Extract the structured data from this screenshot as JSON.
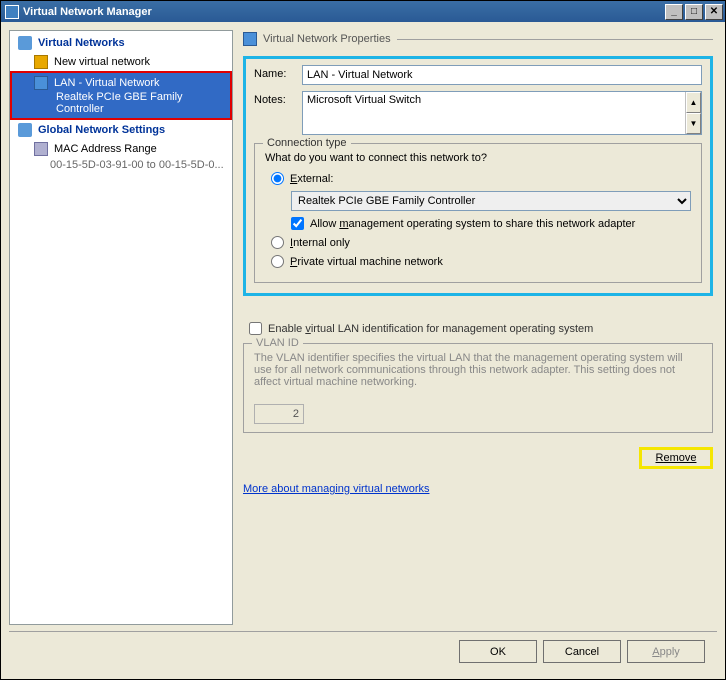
{
  "window": {
    "title": "Virtual Network Manager"
  },
  "sidebar": {
    "section1": "Virtual Networks",
    "new_item": "New virtual network",
    "selected": {
      "name": "LAN - Virtual Network",
      "adapter": "Realtek PCIe GBE Family Controller"
    },
    "section2": "Global Network Settings",
    "mac_label": "MAC Address Range",
    "mac_range": "00-15-5D-03-91-00 to 00-15-5D-0..."
  },
  "props": {
    "section_title": "Virtual Network Properties",
    "name_label": "Name:",
    "name_value": "LAN - Virtual Network",
    "notes_label": "Notes:",
    "notes_value": "Microsoft Virtual Switch",
    "conn": {
      "legend": "Connection type",
      "question": "What do you want to connect this network to?",
      "external_label": "External:",
      "external_u": "E",
      "adapter": "Realtek PCIe GBE Family Controller",
      "allow_label_pre": "Allow ",
      "allow_u": "m",
      "allow_label_post": "anagement operating system to share this network adapter",
      "internal_label": "nternal only",
      "internal_u": "I",
      "private_label": "rivate virtual machine network",
      "private_u": "P"
    },
    "vlan_check_pre": "Enable ",
    "vlan_check_u": "v",
    "vlan_check_post": "irtual LAN identification for management operating system",
    "vlan": {
      "legend": "VLAN ID",
      "desc": "The VLAN identifier specifies the virtual LAN that the management operating system will use for all network communications through this network adapter. This setting does not affect virtual machine networking.",
      "value": "2"
    },
    "remove_u": "R",
    "remove_post": "emove",
    "link": "More about managing virtual networks"
  },
  "footer": {
    "ok": "OK",
    "cancel": "Cancel",
    "apply_u": "A",
    "apply_post": "pply"
  }
}
